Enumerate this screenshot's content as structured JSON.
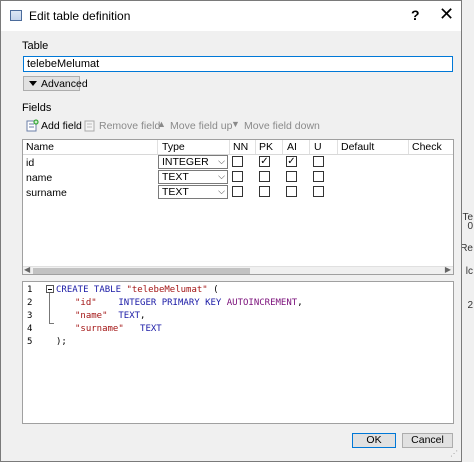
{
  "window": {
    "title": "Edit table definition",
    "help_glyph": "?",
    "close_glyph": "✕"
  },
  "table_group": {
    "label": "Table",
    "name_value": "telebeMelumat",
    "advanced_label": "Advanced"
  },
  "fields_group": {
    "label": "Fields",
    "toolbar": {
      "add": "Add field",
      "remove": "Remove field",
      "move_up": "Move field up",
      "move_down": "Move field down"
    },
    "columns": {
      "name": "Name",
      "type": "Type",
      "nn": "NN",
      "pk": "PK",
      "ai": "AI",
      "u": "U",
      "default": "Default",
      "check": "Check"
    },
    "rows": [
      {
        "name": "id",
        "type": "INTEGER",
        "nn": false,
        "pk": true,
        "ai": true,
        "u": false
      },
      {
        "name": "name",
        "type": "TEXT",
        "nn": false,
        "pk": false,
        "ai": false,
        "u": false
      },
      {
        "name": "surname",
        "type": "TEXT",
        "nn": false,
        "pk": false,
        "ai": false,
        "u": false
      }
    ]
  },
  "sql": {
    "line_numbers": [
      "1",
      "2",
      "3",
      "4",
      "5"
    ],
    "create_kw": "CREATE TABLE",
    "table_name": "\"telebeMelumat\"",
    "open_paren": " (",
    "id_field": "\"id\"",
    "id_type": "INTEGER PRIMARY KEY",
    "id_auto": "AUTOINCREMENT",
    "comma": ",",
    "name_field": "\"name\"",
    "name_type": "TEXT",
    "surname_field": "\"surname\"",
    "surname_type": "TEXT",
    "close": ");"
  },
  "buttons": {
    "ok": "OK",
    "cancel": "Cancel"
  },
  "background_fragments": [
    "Te",
    "0",
    "Re",
    "lc",
    "2"
  ],
  "colors": {
    "accent": "#0078d7",
    "sql_keyword": "#1a1aa6",
    "sql_string": "#a31515",
    "sql_keyword2": "#7a0f7a"
  }
}
